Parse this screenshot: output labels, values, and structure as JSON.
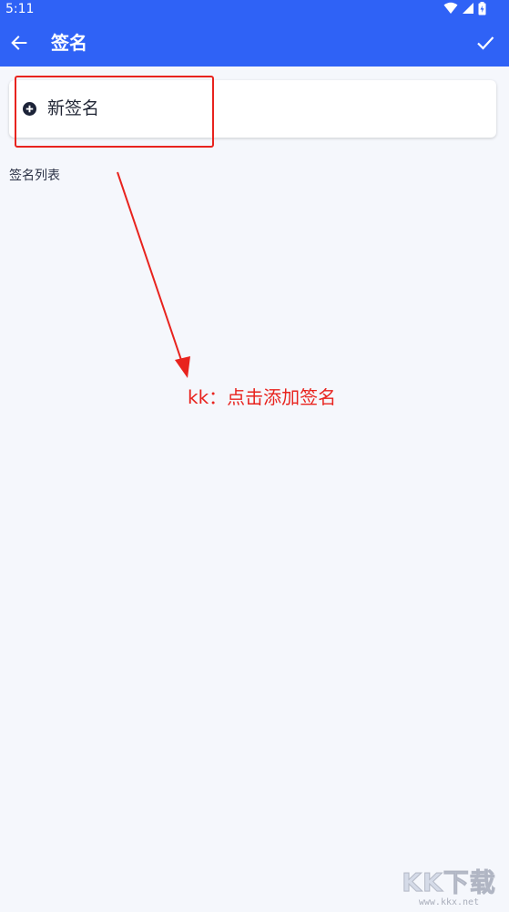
{
  "status_bar": {
    "time": "5:11"
  },
  "app_bar": {
    "title": "签名",
    "back_icon": "arrow-left-icon",
    "confirm_icon": "check-icon"
  },
  "new_signature": {
    "label": "新签名",
    "icon": "plus-circle-icon"
  },
  "signature_list": {
    "section_title": "签名列表"
  },
  "annotation": {
    "text": "kk：点击添加签名",
    "color": "#E8231E"
  },
  "watermark": {
    "logo": "KK下载",
    "url": "www.kkx.net"
  },
  "colors": {
    "primary": "#2F62F6",
    "background": "#F5F7FC",
    "card": "#FFFFFF",
    "text": "#1F2433"
  }
}
